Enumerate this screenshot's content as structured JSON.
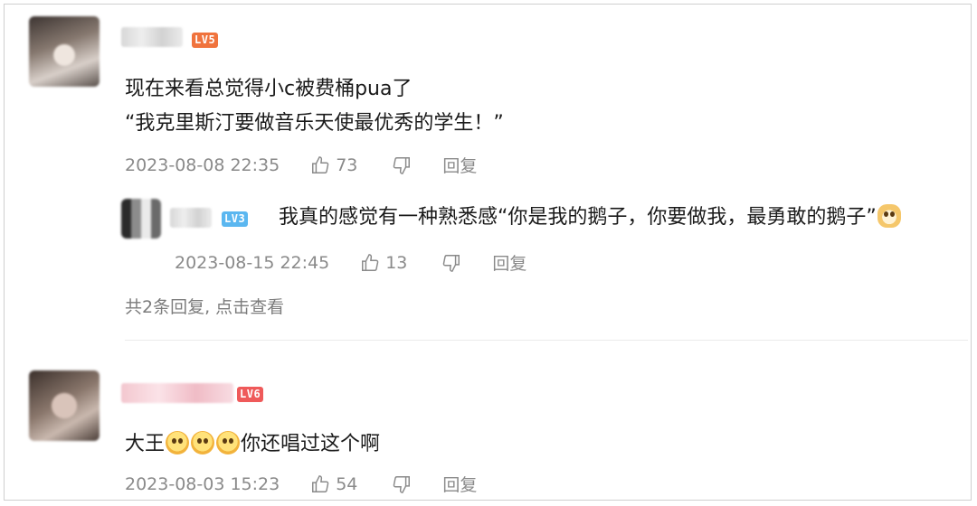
{
  "comments": [
    {
      "level": "LV5",
      "text_line1": "现在来看总觉得小c被费桶pua了",
      "text_line2": "“我克里斯汀要做音乐天使最优秀的学生！”",
      "time": "2023-08-08 22:35",
      "likes": "73",
      "reply_label": "回复"
    },
    {
      "level": "LV6",
      "text_prefix": "大王",
      "text_suffix": "你还唱过这个啊",
      "emoji_icons": [
        "astonished-face-icon",
        "astonished-face-icon",
        "astonished-face-icon"
      ],
      "time": "2023-08-03 15:23",
      "likes": "54",
      "reply_label": "回复"
    }
  ],
  "reply": {
    "level": "LV3",
    "text": "我真的感觉有一种熟悉感“你是我的鹅子，你要做我，最勇敢的鹅子”",
    "emoji_icon": "doge-emoji-icon",
    "time": "2023-08-15 22:45",
    "likes": "13",
    "reply_label": "回复"
  },
  "more_replies": "共2条回复, 点击查看"
}
